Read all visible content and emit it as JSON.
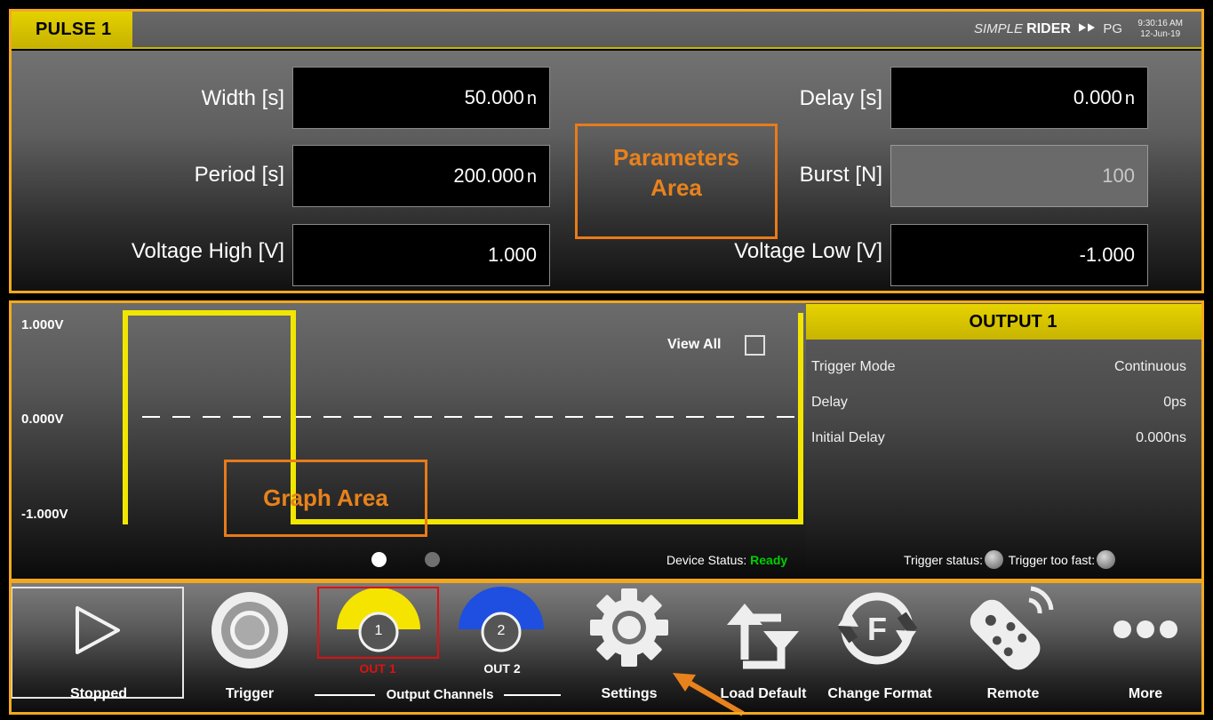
{
  "header": {
    "title": "PULSE 1",
    "brand_simple": "SIMPLE",
    "brand_rider": "RIDER",
    "brand_arrows": "⯈⯈",
    "brand_pg": "PG",
    "time": "9:30:16 AM",
    "date": "12-Jun-19"
  },
  "parameters": {
    "width_label": "Width [s]",
    "width_value": "50.000",
    "width_unit": "n",
    "period_label": "Period [s]",
    "period_value": "200.000",
    "period_unit": "n",
    "vhigh_label": "Voltage High [V]",
    "vhigh_value": "1.000",
    "delay_label": "Delay [s]",
    "delay_value": "0.000",
    "delay_unit": "n",
    "burst_label": "Burst [N]",
    "burst_value": "100",
    "vlow_label": "Voltage Low [V]",
    "vlow_value": "-1.000"
  },
  "annotations": {
    "params_line1": "Parameters",
    "params_line2": "Area",
    "graph": "Graph Area"
  },
  "graph": {
    "y_high": "1.000V",
    "y_zero": "0.000V",
    "y_low": "-1.000V",
    "view_all": "View All",
    "device_status_label": "Device Status:",
    "device_status_value": "Ready",
    "waveform_color": "#f2e600"
  },
  "output": {
    "title": "OUTPUT 1",
    "trigger_mode_label": "Trigger Mode",
    "trigger_mode_value": "Continuous",
    "delay_label": "Delay",
    "delay_value": "0ps",
    "initial_delay_label": "Initial Delay",
    "initial_delay_value": "0.000ns",
    "trigger_status_label": "Trigger status:",
    "trigger_too_fast_label": "Trigger too fast:"
  },
  "toolbar": {
    "stopped": "Stopped",
    "trigger": "Trigger",
    "out1_num": "1",
    "out1": "OUT 1",
    "out2_num": "2",
    "out2": "OUT 2",
    "output_channels": "Output Channels",
    "settings": "Settings",
    "load_default": "Load Default",
    "change_format": "Change Format",
    "remote": "Remote",
    "more": "More",
    "out1_color": "#f5e400",
    "out2_color": "#1f4fe0",
    "out1_label_color": "#e01010"
  },
  "colors": {
    "accent": "#f2a81d",
    "title_yellow": "#e4d100",
    "annotation_orange": "#e87b1a"
  }
}
